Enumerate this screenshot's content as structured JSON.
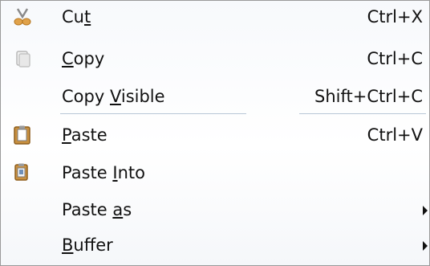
{
  "menu": {
    "items": [
      {
        "pre": "Cu",
        "acc": "t",
        "post": "",
        "shortcut": "Ctrl+X",
        "icon": "scissors-icon"
      },
      {
        "pre": "",
        "acc": "C",
        "post": "opy",
        "shortcut": "Ctrl+C",
        "icon": "copy-icon"
      },
      {
        "pre": "Copy ",
        "acc": "V",
        "post": "isible",
        "shortcut": "Shift+Ctrl+C",
        "icon": ""
      },
      {
        "pre": "",
        "acc": "P",
        "post": "aste",
        "shortcut": "Ctrl+V",
        "icon": "paste-icon"
      },
      {
        "pre": "Paste ",
        "acc": "I",
        "post": "nto",
        "shortcut": "",
        "icon": "paste-into-icon"
      },
      {
        "pre": "Paste ",
        "acc": "a",
        "post": "s",
        "shortcut": "",
        "icon": "",
        "submenu": true
      },
      {
        "pre": "",
        "acc": "B",
        "post": "uffer",
        "shortcut": "",
        "icon": "",
        "submenu": true
      }
    ]
  },
  "colors": {
    "text": "#111111",
    "border": "#9a9a9a",
    "separator": "#b9c7d6"
  }
}
